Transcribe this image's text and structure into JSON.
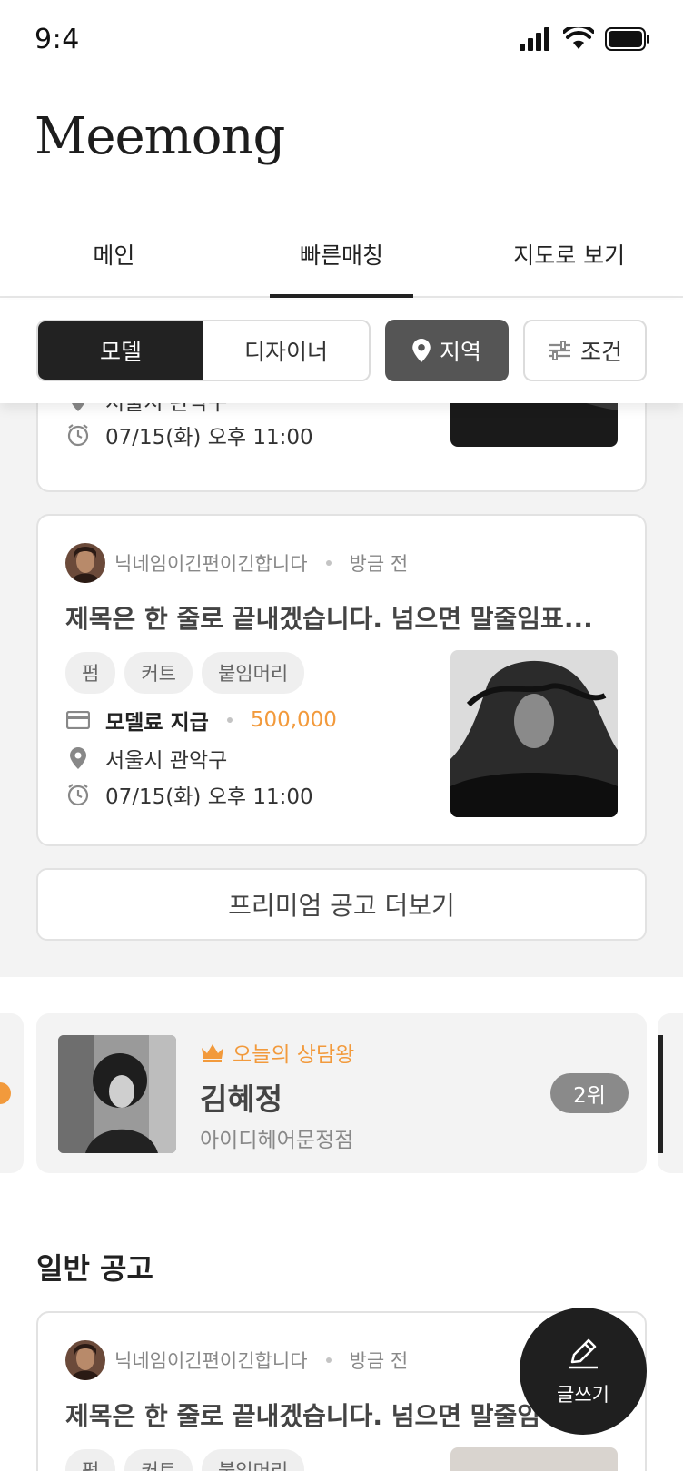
{
  "status_bar": {
    "time": "9:4"
  },
  "app": {
    "title": "Meemong"
  },
  "tabs": [
    {
      "label": "메인"
    },
    {
      "label": "빠른매칭"
    },
    {
      "label": "지도로 보기"
    }
  ],
  "filters": {
    "segment": [
      {
        "label": "모델"
      },
      {
        "label": "디자이너"
      }
    ],
    "region_label": "지역",
    "condition_label": "조건"
  },
  "premium": {
    "card1": {
      "location": "서울시 관악구",
      "datetime": "07/15(화) 오후 11:00"
    },
    "card2": {
      "nickname": "닉네임이긴편이긴합니다",
      "time_ago": "방금 전",
      "title": "제목은 한 줄로 끝내겠습니다. 넘으면 말줄임표...",
      "tags": [
        "펌",
        "커트",
        "붙임머리"
      ],
      "fee_label": "모델료 지급",
      "fee_value": "500,000",
      "location": "서울시 관악구",
      "datetime": "07/15(화) 오후 11:00"
    },
    "more_label": "프리미엄 공고 더보기"
  },
  "ranking": {
    "kicker": "오늘의 상담왕",
    "name": "김혜정",
    "shop": "아이디헤어문정점",
    "rank": "2위"
  },
  "general": {
    "section_title": "일반 공고",
    "card": {
      "nickname": "닉네임이긴편이긴합니다",
      "time_ago": "방금 전",
      "title": "제목은 한 줄로 끝내겠습니다. 넘으면 말줄임",
      "tags": [
        "펌",
        "커트",
        "붙임머리"
      ]
    }
  },
  "fab": {
    "label": "글쓰기"
  },
  "colors": {
    "accent": "#f29a3c",
    "dark": "#222222",
    "region_bg": "#555555"
  }
}
